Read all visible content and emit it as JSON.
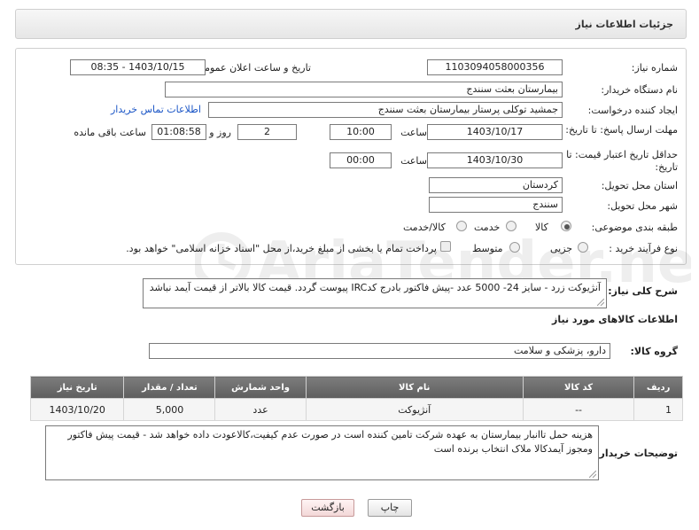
{
  "header": {
    "title": "جزئیات اطلاعات نیاز"
  },
  "form": {
    "need_number_label": "شماره نیاز:",
    "need_number": "1103094058000356",
    "announce_label": "تاریخ و ساعت اعلان عمومی:",
    "announce_value": "1403/10/15 - 08:35",
    "buyer_org_label": "نام دستگاه خریدار:",
    "buyer_org": "بیمارستان بعثت سنندج",
    "creator_label": "ایجاد کننده درخواست:",
    "creator": "جمشید  توکلی پرستار بیمارستان بعثت سنندج",
    "contact_link": "اطلاعات تماس خریدار",
    "reply_deadline_label": "مهلت ارسال پاسخ: تا تاریخ:",
    "reply_date": "1403/10/17",
    "hour_label": "ساعت",
    "reply_time": "10:00",
    "days_count": "2",
    "days_label": "روز و",
    "remaining_time": "01:08:58",
    "remaining_label": "ساعت باقی مانده",
    "price_validity_label": "حداقل تاریخ اعتبار قیمت: تا تاریخ:",
    "price_validity_date": "1403/10/30",
    "price_validity_time": "00:00",
    "province_label": "استان محل تحویل:",
    "province": "کردستان",
    "city_label": "شهر محل تحویل:",
    "city": "سنندج",
    "category_label": "طبقه بندی موضوعی:",
    "category_options": [
      "کالا",
      "خدمت",
      "کالا/خدمت"
    ],
    "category_selected": "کالا",
    "process_label": "نوع فرآیند خرید :",
    "process_options": [
      "جزیی",
      "متوسط"
    ],
    "payment_note": "پرداخت تمام یا بخشی از مبلغ خرید،از محل \"اسناد خزانه اسلامی\" خواهد بود."
  },
  "description": {
    "label": "شرح کلی نیاز:",
    "text": "آنژیوکت زرد - سایز 24- 5000 عدد -پیش فاکتور بادرج کدIRC پیوست گردد. قیمت کالا بالاتر از قیمت آیمد نباشد"
  },
  "goods": {
    "section_title": "اطلاعات کالاهای مورد نیاز",
    "group_label": "گروه کالا:",
    "group_value": "دارو، پزشکی و سلامت",
    "columns": [
      "ردیف",
      "کد کالا",
      "نام کالا",
      "واحد شمارش",
      "تعداد / مقدار",
      "تاریخ نیاز"
    ],
    "rows": [
      {
        "row": "1",
        "code": "--",
        "name": "آنژیوکت",
        "unit": "عدد",
        "qty": "5,000",
        "date": "1403/10/20"
      }
    ]
  },
  "buyer_notes": {
    "label": "توضیحات خریدار:",
    "text": "هزینه حمل تاانبار بیمارستان به عهده شرکت تامین کننده است در صورت عدم کیفیت،کالاعودت داده خواهد شد - قیمت پیش فاکتور ومجوز آیمدکالا ملاک انتخاب برنده است"
  },
  "buttons": {
    "print": "چاپ",
    "back": "بازگشت"
  },
  "watermark": {
    "text": "AriaTender.net"
  },
  "colors": {
    "link": "#1a55c6",
    "table_header": "#6b6b6b",
    "back_button": "#f3d8d8"
  }
}
